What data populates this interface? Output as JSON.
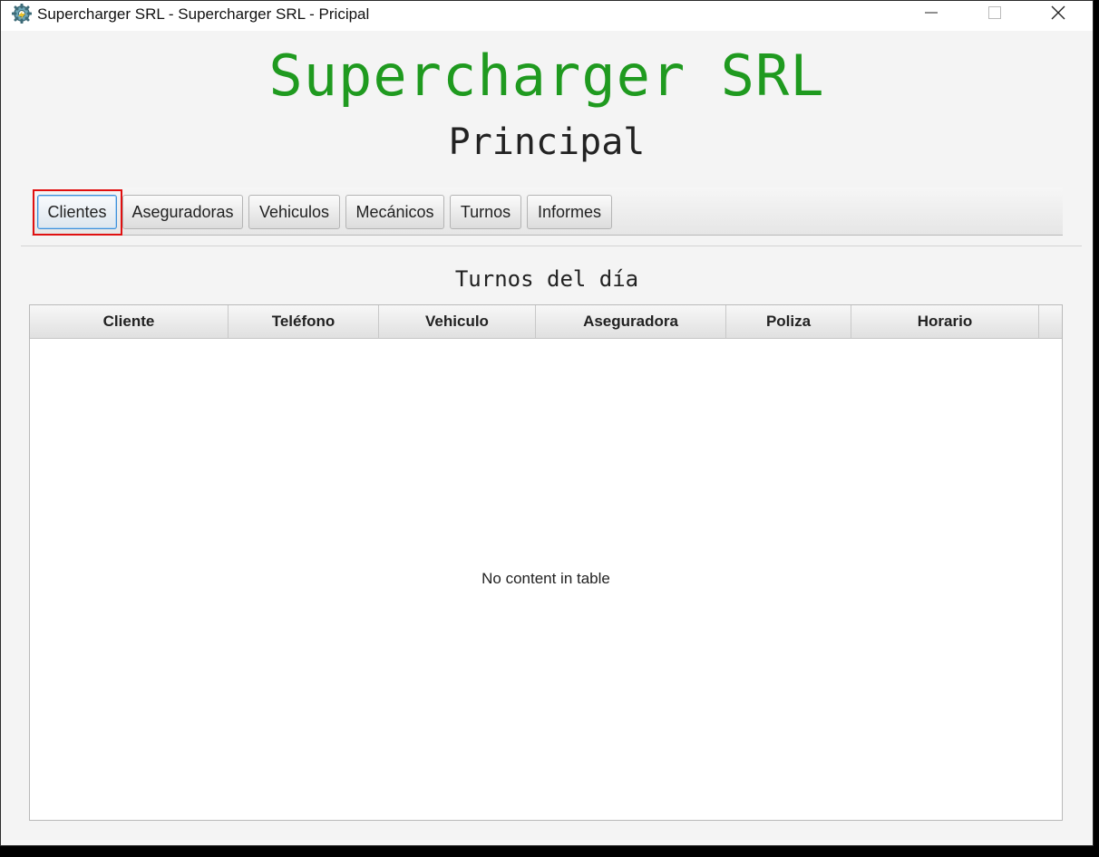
{
  "window": {
    "title": "Supercharger SRL - Supercharger SRL - Pricipal"
  },
  "header": {
    "app_title": "Supercharger SRL",
    "page_title": "Principal"
  },
  "toolbar": {
    "buttons": [
      {
        "label": "Clientes",
        "focused": true
      },
      {
        "label": "Aseguradoras"
      },
      {
        "label": "Vehiculos"
      },
      {
        "label": "Mecánicos"
      },
      {
        "label": "Turnos"
      },
      {
        "label": "Informes"
      }
    ]
  },
  "section": {
    "title": "Turnos del día"
  },
  "table": {
    "columns": [
      "Cliente",
      "Teléfono",
      "Vehiculo",
      "Aseguradora",
      "Poliza",
      "Horario"
    ],
    "rows": [],
    "empty_message": "No content in table"
  },
  "colors": {
    "app_title": "#1f9a1f",
    "highlight": "#e01010",
    "focus_border": "#3f8fd8"
  },
  "icons": {
    "app": "gear-icon",
    "minimize": "minimize-icon",
    "maximize": "maximize-icon",
    "close": "close-icon"
  }
}
